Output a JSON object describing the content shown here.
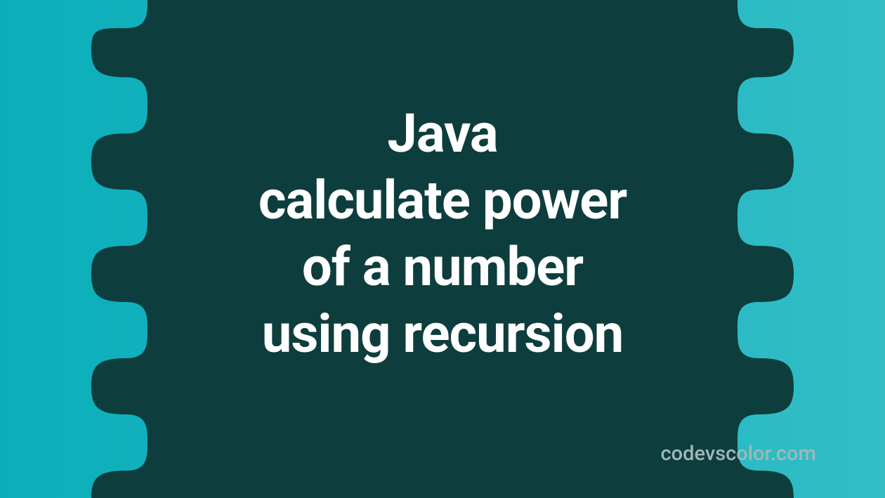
{
  "title": {
    "line1": "Java",
    "line2": "calculate power",
    "line3": "of a number",
    "line4": "using recursion"
  },
  "credit": "codevscolor.com",
  "colors": {
    "bg_gradient_start": "#0bafba",
    "bg_gradient_end": "#33bec6",
    "blob": "#0e3d3d",
    "text": "#ffffff",
    "credit": "#9fb8b8"
  }
}
